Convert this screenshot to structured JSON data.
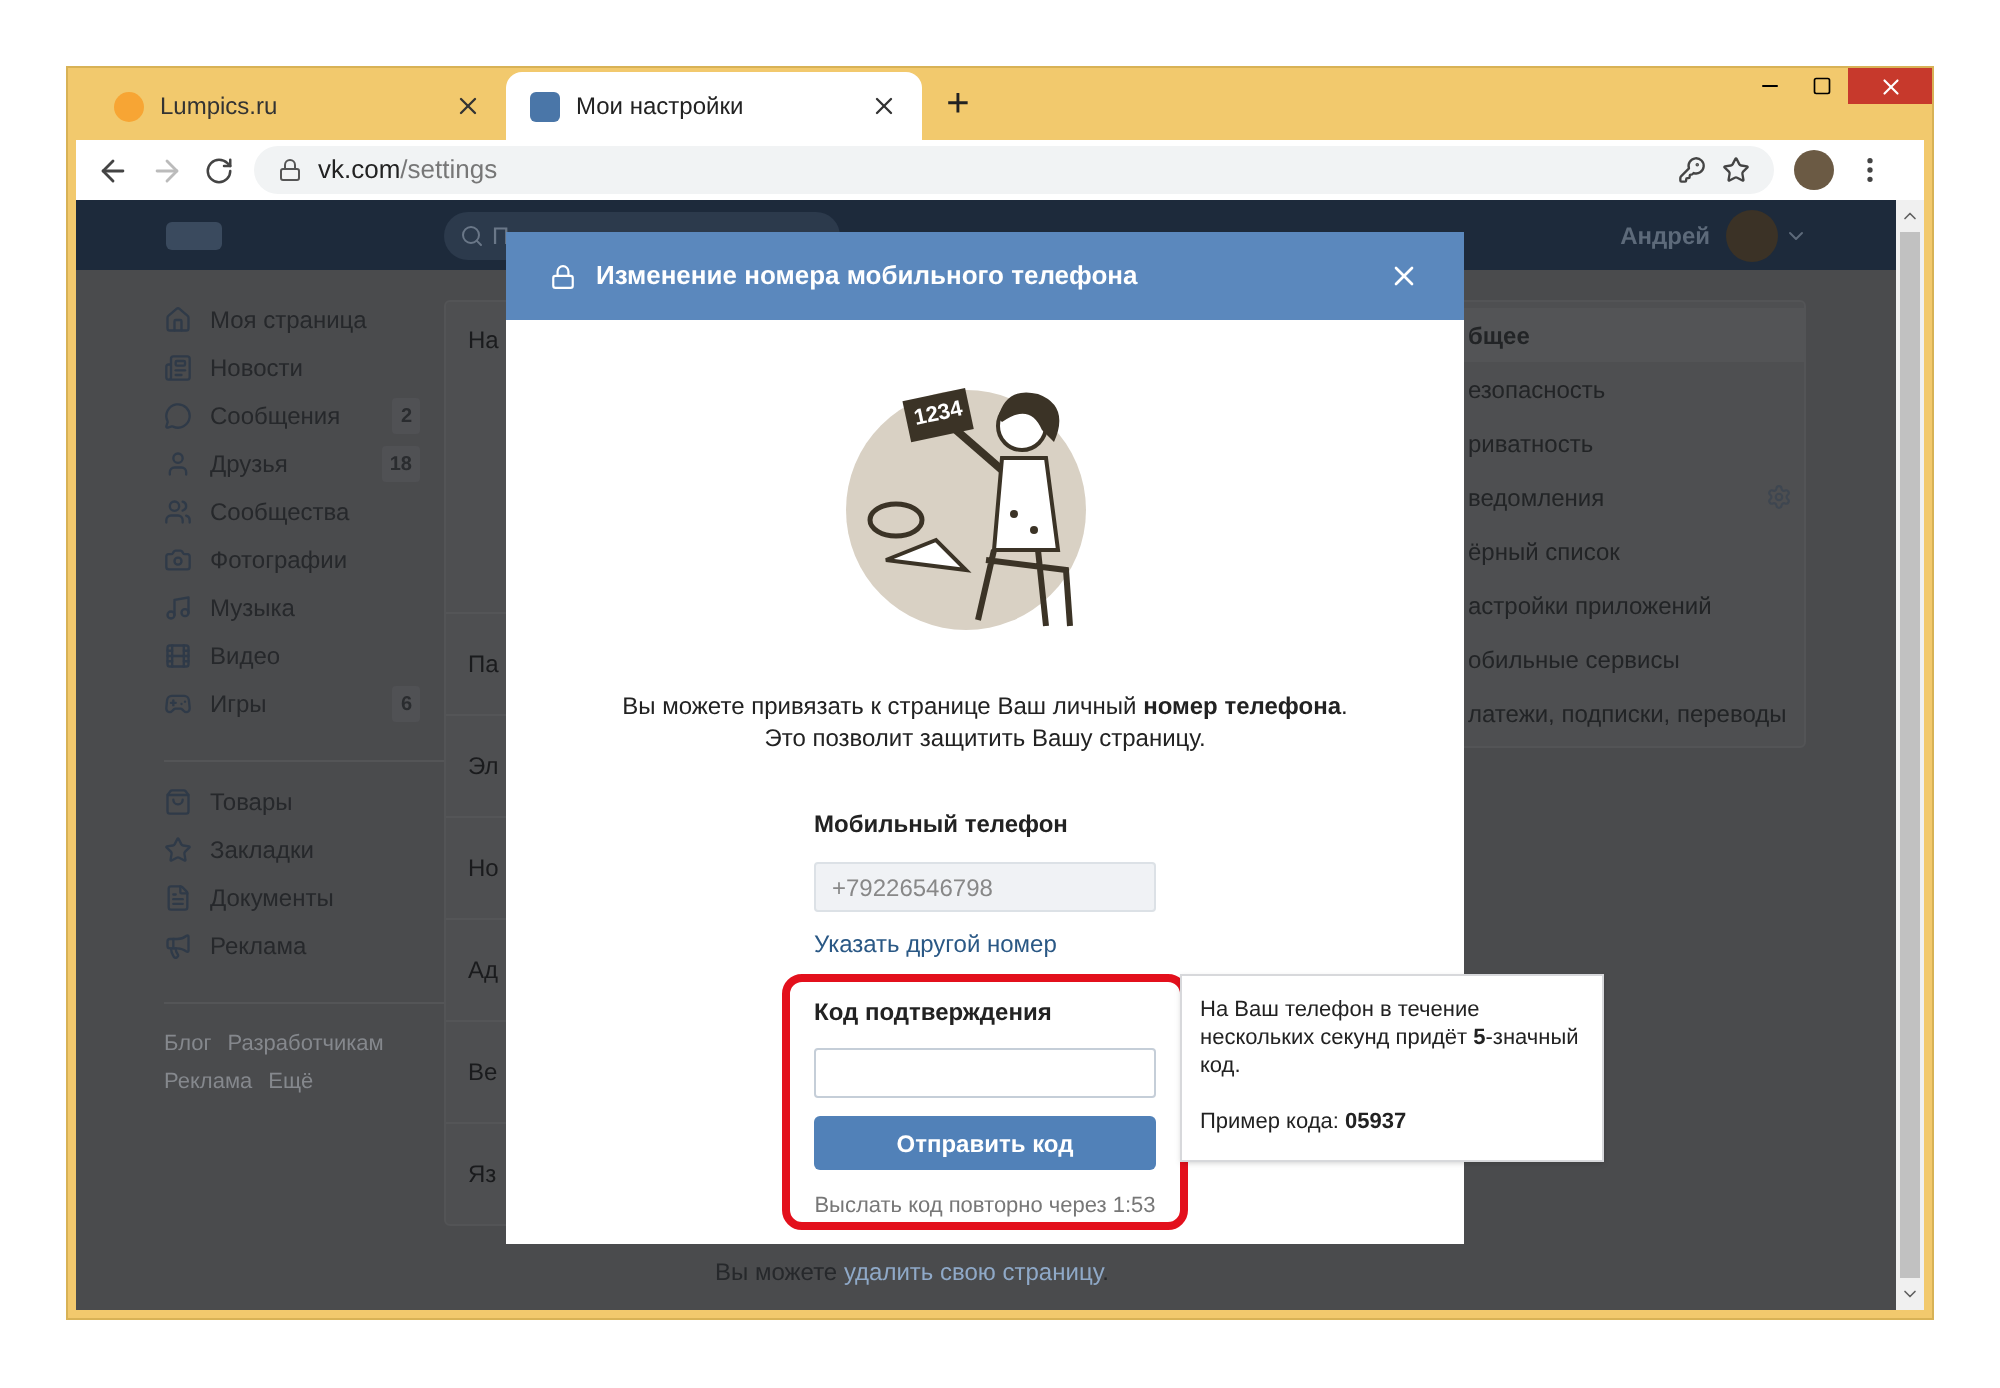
{
  "browser": {
    "tabs": [
      {
        "title": "Lumpics.ru",
        "selected": false
      },
      {
        "title": "Мои настройки",
        "selected": true
      }
    ],
    "new_tab": "+",
    "address": {
      "domain": "vk.com",
      "path": "/settings"
    }
  },
  "header": {
    "search_placeholder": "П",
    "user_name": "Андрей"
  },
  "sidebar": {
    "groups": [
      [
        {
          "label": "Моя страница"
        },
        {
          "label": "Новости"
        },
        {
          "label": "Сообщения",
          "count": "2"
        },
        {
          "label": "Друзья",
          "count": "18"
        },
        {
          "label": "Сообщества"
        },
        {
          "label": "Фотографии"
        },
        {
          "label": "Музыка"
        },
        {
          "label": "Видео"
        },
        {
          "label": "Игры",
          "count": "6"
        }
      ],
      [
        {
          "label": "Товары"
        },
        {
          "label": "Закладки"
        },
        {
          "label": "Документы"
        },
        {
          "label": "Реклама"
        }
      ]
    ],
    "footer": [
      [
        "Блог",
        "Разработчикам"
      ],
      [
        "Реклама",
        "Ещё"
      ]
    ]
  },
  "settings_card": {
    "rows": [
      "На",
      "Па",
      "Эл",
      "Но",
      "Ад",
      "Ве",
      "Яз"
    ],
    "footer": {
      "text": "Вы можете",
      "link": "удалить свою страницу",
      "end": "."
    }
  },
  "settings_menu": [
    {
      "label": "бщее",
      "selected": true
    },
    {
      "label": "езопасность",
      "selected": false
    },
    {
      "label": "риватность",
      "selected": false
    },
    {
      "label": "ведомления",
      "selected": false
    },
    {
      "label": "ёрный список",
      "selected": false
    },
    {
      "label": "астройки приложений",
      "selected": false
    },
    {
      "label": "обильные сервисы",
      "selected": false
    },
    {
      "label": "латежи, подписки, переводы",
      "selected": false
    }
  ],
  "modal": {
    "title": "Изменение номера мобильного телефона",
    "illustration_sign": "1234",
    "intro": [
      "Вы можете привязать к странице Ваш личный **номер телефона**.",
      "Это позволит защитить Вашу страницу."
    ],
    "phone_label": "Мобильный телефон",
    "phone_value": "+79226546798",
    "change_link": "Указать другой номер",
    "code_label": "Код подтверждения",
    "send_button": "Отправить код",
    "resend_note": "Выслать код повторно через 1:53",
    "highlighted": true
  },
  "tooltip": {
    "text": "На Ваш телефон в течение нескольких секунд придёт **5**-значный код.",
    "example": "Пример кода: **05937**"
  }
}
